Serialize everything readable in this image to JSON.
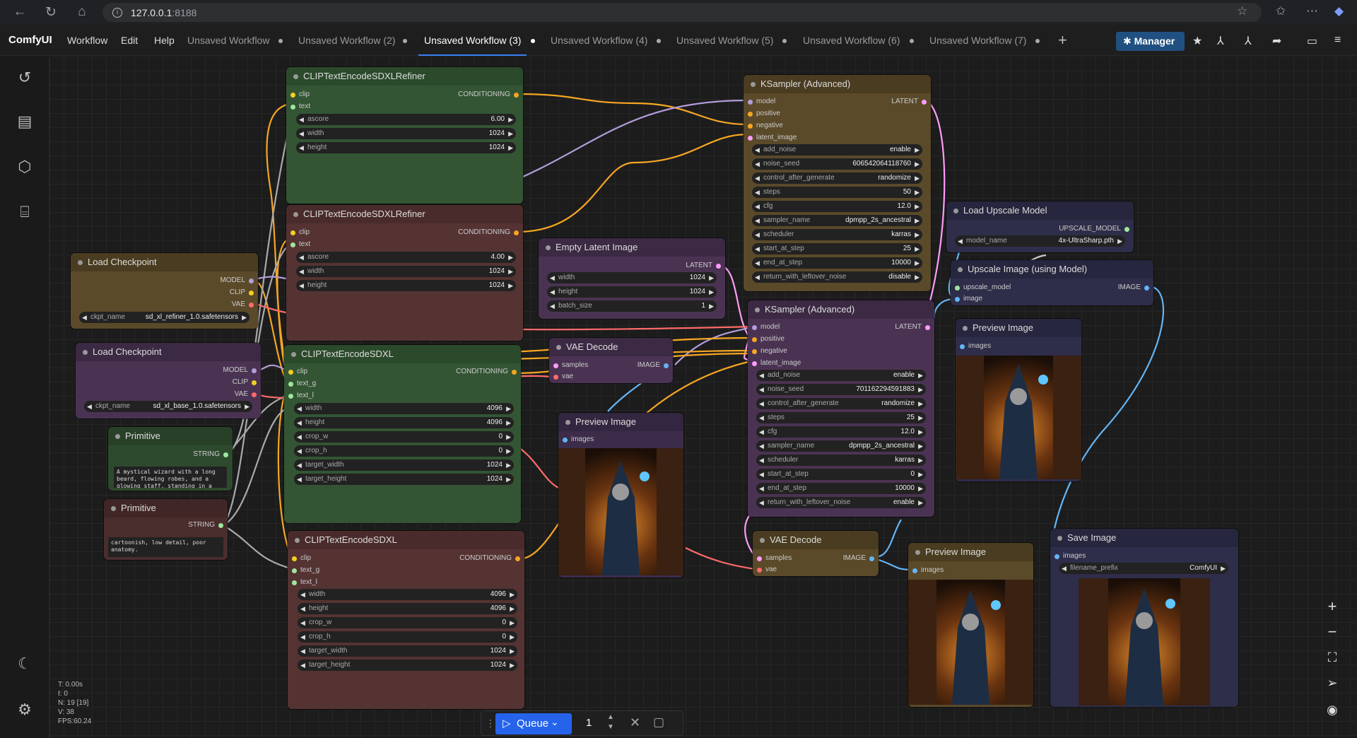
{
  "browser": {
    "url_host": "127.0.0.1",
    "url_port": ":8188"
  },
  "menu": {
    "logo": "ComfyUI",
    "items": [
      "Workflow",
      "Edit",
      "Help"
    ]
  },
  "tabs": [
    {
      "label": "Unsaved Workflow"
    },
    {
      "label": "Unsaved Workflow (2)"
    },
    {
      "label": "Unsaved Workflow (3)"
    },
    {
      "label": "Unsaved Workflow (4)"
    },
    {
      "label": "Unsaved Workflow (5)"
    },
    {
      "label": "Unsaved Workflow (6)"
    },
    {
      "label": "Unsaved Workflow (7)"
    }
  ],
  "manager_label": "Manager",
  "stats": {
    "t": "T: 0.00s",
    "i": "I: 0",
    "n": "N: 19 [19]",
    "v": "V: 38",
    "fps": "FPS:60.24"
  },
  "queue": {
    "label": "Queue",
    "count": "1"
  },
  "nodes": {
    "refiner1": {
      "title": "CLIPTextEncodeSDXLRefiner",
      "in": [
        "clip",
        "text"
      ],
      "out": "CONDITIONING",
      "widgets": [
        {
          "l": "ascore",
          "v": "6.00"
        },
        {
          "l": "width",
          "v": "1024"
        },
        {
          "l": "height",
          "v": "1024"
        }
      ]
    },
    "refiner2": {
      "title": "CLIPTextEncodeSDXLRefiner",
      "in": [
        "clip",
        "text"
      ],
      "out": "CONDITIONING",
      "widgets": [
        {
          "l": "ascore",
          "v": "4.00"
        },
        {
          "l": "width",
          "v": "1024"
        },
        {
          "l": "height",
          "v": "1024"
        }
      ]
    },
    "ckpt1": {
      "title": "Load Checkpoint",
      "out": [
        "MODEL",
        "CLIP",
        "VAE"
      ],
      "widget": {
        "l": "ckpt_name",
        "v": "sd_xl_refiner_1.0.safetensors"
      }
    },
    "ckpt2": {
      "title": "Load Checkpoint",
      "out": [
        "MODEL",
        "CLIP",
        "VAE"
      ],
      "widget": {
        "l": "ckpt_name",
        "v": "sd_xl_base_1.0.safetensors"
      }
    },
    "prim1": {
      "title": "Primitive",
      "out": "STRING",
      "text": "A mystical wizard with a long beard, flowing robes, and a glowing staff, standing in a"
    },
    "prim2": {
      "title": "Primitive",
      "out": "STRING",
      "text": "cartoonish, low detail, poor anatomy."
    },
    "sdxl1": {
      "title": "CLIPTextEncodeSDXL",
      "in": [
        "clip",
        "text_g",
        "text_l"
      ],
      "out": "CONDITIONING",
      "widgets": [
        {
          "l": "width",
          "v": "4096"
        },
        {
          "l": "height",
          "v": "4096"
        },
        {
          "l": "crop_w",
          "v": "0"
        },
        {
          "l": "crop_h",
          "v": "0"
        },
        {
          "l": "target_width",
          "v": "1024"
        },
        {
          "l": "target_height",
          "v": "1024"
        }
      ]
    },
    "sdxl2": {
      "title": "CLIPTextEncodeSDXL",
      "in": [
        "clip",
        "text_g",
        "text_l"
      ],
      "out": "CONDITIONING",
      "widgets": [
        {
          "l": "width",
          "v": "4096"
        },
        {
          "l": "height",
          "v": "4096"
        },
        {
          "l": "crop_w",
          "v": "0"
        },
        {
          "l": "crop_h",
          "v": "0"
        },
        {
          "l": "target_width",
          "v": "1024"
        },
        {
          "l": "target_height",
          "v": "1024"
        }
      ]
    },
    "latent": {
      "title": "Empty Latent Image",
      "out": "LATENT",
      "widgets": [
        {
          "l": "width",
          "v": "1024"
        },
        {
          "l": "height",
          "v": "1024"
        },
        {
          "l": "batch_size",
          "v": "1"
        }
      ]
    },
    "vae1": {
      "title": "VAE Decode",
      "in": [
        "samples",
        "vae"
      ],
      "out": "IMAGE"
    },
    "vae2": {
      "title": "VAE Decode",
      "in": [
        "samples",
        "vae"
      ],
      "out": "IMAGE"
    },
    "prev1": {
      "title": "Preview Image",
      "in": "images"
    },
    "prev2": {
      "title": "Preview Image",
      "in": "images"
    },
    "prev3": {
      "title": "Preview Image",
      "in": "images"
    },
    "ks1": {
      "title": "KSampler (Advanced)",
      "in": [
        "model",
        "positive",
        "negative",
        "latent_image"
      ],
      "out": "LATENT",
      "widgets": [
        {
          "l": "add_noise",
          "v": "enable"
        },
        {
          "l": "noise_seed",
          "v": "606542064118760"
        },
        {
          "l": "control_after_generate",
          "v": "randomize"
        },
        {
          "l": "steps",
          "v": "50"
        },
        {
          "l": "cfg",
          "v": "12.0"
        },
        {
          "l": "sampler_name",
          "v": "dpmpp_2s_ancestral"
        },
        {
          "l": "scheduler",
          "v": "karras"
        },
        {
          "l": "start_at_step",
          "v": "25"
        },
        {
          "l": "end_at_step",
          "v": "10000"
        },
        {
          "l": "return_with_leftover_noise",
          "v": "disable"
        }
      ]
    },
    "ks2": {
      "title": "KSampler (Advanced)",
      "in": [
        "model",
        "positive",
        "negative",
        "latent_image"
      ],
      "out": "LATENT",
      "widgets": [
        {
          "l": "add_noise",
          "v": "enable"
        },
        {
          "l": "noise_seed",
          "v": "701162294591883"
        },
        {
          "l": "control_after_generate",
          "v": "randomize"
        },
        {
          "l": "steps",
          "v": "25"
        },
        {
          "l": "cfg",
          "v": "12.0"
        },
        {
          "l": "sampler_name",
          "v": "dpmpp_2s_ancestral"
        },
        {
          "l": "scheduler",
          "v": "karras"
        },
        {
          "l": "start_at_step",
          "v": "0"
        },
        {
          "l": "end_at_step",
          "v": "10000"
        },
        {
          "l": "return_with_leftover_noise",
          "v": "enable"
        }
      ]
    },
    "upload": {
      "title": "Load Upscale Model",
      "out": "UPSCALE_MODEL",
      "widget": {
        "l": "model_name",
        "v": "4x-UltraSharp.pth"
      }
    },
    "upscale": {
      "title": "Upscale Image (using Model)",
      "in": [
        "upscale_model",
        "image"
      ],
      "out": "IMAGE"
    },
    "save": {
      "title": "Save Image",
      "in": "images",
      "widget": {
        "l": "filename_prefix",
        "v": "ComfyUI"
      }
    }
  }
}
